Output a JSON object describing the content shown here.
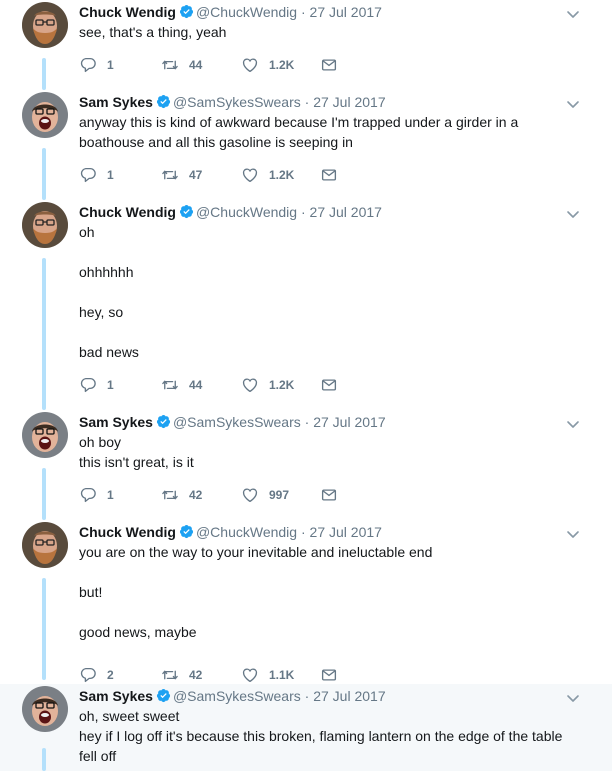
{
  "users": {
    "chuck": {
      "name": "Chuck Wendig",
      "handle": "@ChuckWendig",
      "avatar_icon": "bearded-man-avatar"
    },
    "sam": {
      "name": "Sam Sykes",
      "handle": "@SamSykesSwears",
      "avatar_icon": "shouting-man-avatar"
    }
  },
  "separator": "·",
  "colors": {
    "accent": "#1da1f2",
    "thread_line": "#b4e0fb",
    "muted": "#657786",
    "highlight_bg": "#f5f8fa"
  },
  "tweets": [
    {
      "author": "chuck",
      "name": "Chuck Wendig",
      "handle": "@ChuckWendig",
      "date": "27 Jul 2017",
      "lines": [
        "see, that's a thing, yeah"
      ],
      "replies": "1",
      "retweets": "44",
      "likes": "1.2K"
    },
    {
      "author": "sam",
      "name": "Sam Sykes",
      "handle": "@SamSykesSwears",
      "date": "27 Jul 2017",
      "lines": [
        "anyway this is kind of awkward because I'm trapped under a girder in a",
        "boathouse and all this gasoline is seeping in"
      ],
      "replies": "1",
      "retweets": "47",
      "likes": "1.2K"
    },
    {
      "author": "chuck",
      "name": "Chuck Wendig",
      "handle": "@ChuckWendig",
      "date": "27 Jul 2017",
      "lines": [
        "oh",
        "",
        "ohhhhhh",
        "",
        "hey, so",
        "",
        "bad news"
      ],
      "replies": "1",
      "retweets": "44",
      "likes": "1.2K"
    },
    {
      "author": "sam",
      "name": "Sam Sykes",
      "handle": "@SamSykesSwears",
      "date": "27 Jul 2017",
      "lines": [
        "oh boy",
        "this isn't great, is it"
      ],
      "replies": "1",
      "retweets": "42",
      "likes": "997"
    },
    {
      "author": "chuck",
      "name": "Chuck Wendig",
      "handle": "@ChuckWendig",
      "date": "27 Jul 2017",
      "lines": [
        "you are on the way to your inevitable and ineluctable end",
        "",
        "but!",
        "",
        "good news, maybe"
      ],
      "replies": "2",
      "retweets": "42",
      "likes": "1.1K"
    },
    {
      "author": "sam",
      "name": "Sam Sykes",
      "handle": "@SamSykesSwears",
      "date": "27 Jul 2017",
      "lines": [
        "oh, sweet sweet",
        "hey if I log off it's because this broken, flaming lantern on the edge of the table",
        "fell off"
      ],
      "highlighted": true
    }
  ]
}
